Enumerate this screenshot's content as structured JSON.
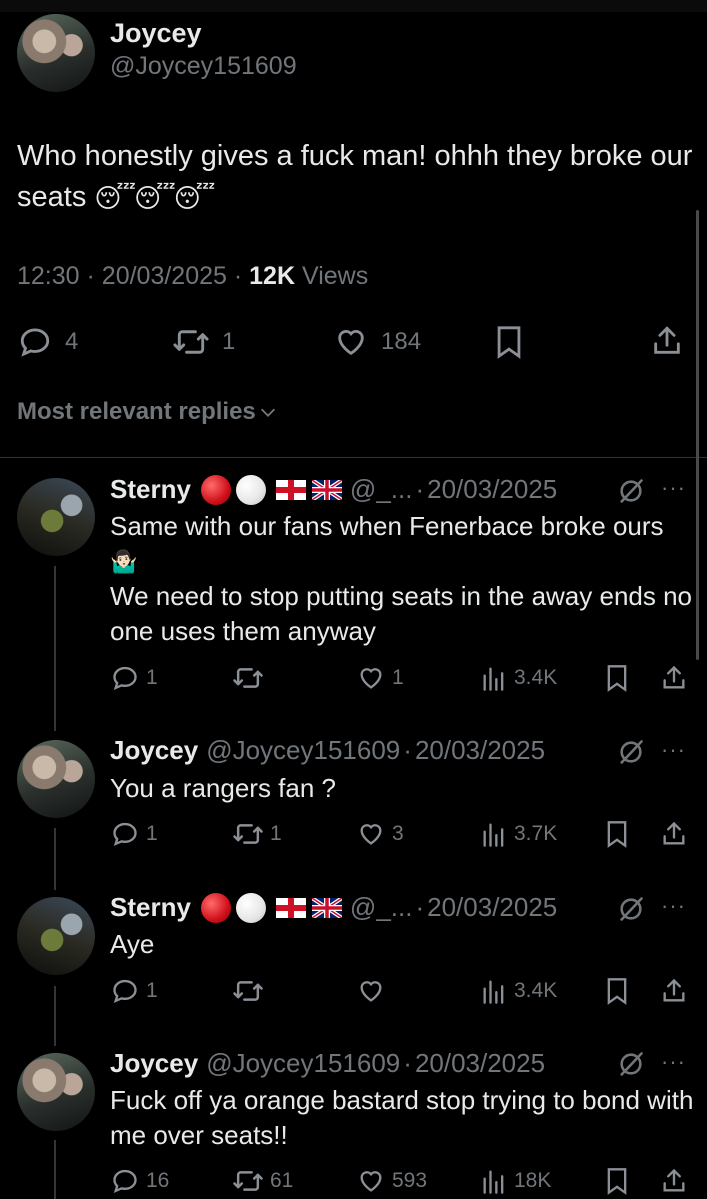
{
  "main_tweet": {
    "author_name": "Joycey",
    "author_handle": "@Joycey151609",
    "text": "Who honestly gives a fuck man! ohhh they broke our seats",
    "emojis": "😴😴😴",
    "time": "12:30",
    "date": "20/03/2025",
    "views_count": "12K",
    "views_label": "Views",
    "replies": "4",
    "reposts": "1",
    "likes": "184"
  },
  "most_relevant_label": "Most relevant replies",
  "replies": [
    {
      "author_name": "Sterny",
      "author_handle": "@_...",
      "date": "20/03/2025",
      "text_line1": "Same with our fans when Fenerbace broke ours",
      "text_emoji": "🤷🏻‍♂️",
      "text_line2": "We need to stop putting seats in the away ends no one uses them anyway",
      "replies": "1",
      "reposts": "",
      "likes": "1",
      "views": "3.4K"
    },
    {
      "author_name": "Joycey",
      "author_handle": "@Joycey151609",
      "date": "20/03/2025",
      "text": "You a rangers fan ?",
      "replies": "1",
      "reposts": "1",
      "likes": "3",
      "views": "3.7K"
    },
    {
      "author_name": "Sterny",
      "author_handle": "@_...",
      "date": "20/03/2025",
      "text": "Aye",
      "replies": "1",
      "reposts": "",
      "likes": "",
      "views": "3.4K"
    },
    {
      "author_name": "Joycey",
      "author_handle": "@Joycey151609",
      "date": "20/03/2025",
      "text": "Fuck off ya orange bastard stop trying to bond with me over seats!!",
      "replies": "16",
      "reposts": "61",
      "likes": "593",
      "views": "18K"
    }
  ],
  "separator": "·",
  "icons": {
    "reply": "reply-icon",
    "repost": "repost-icon",
    "like": "heart-icon",
    "bookmark": "bookmark-icon",
    "share": "share-icon",
    "views": "views-icon",
    "grok": "grok-icon",
    "more": "more-icon",
    "chevron": "chevron-down-icon"
  },
  "colors": {
    "background": "#000000",
    "text": "#e7e9ea",
    "muted": "#71767b",
    "divider": "#2f3336"
  }
}
